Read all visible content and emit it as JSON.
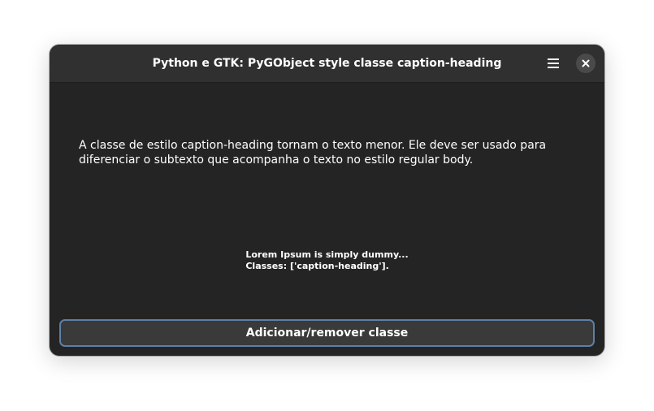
{
  "window": {
    "title": "Python e GTK: PyGObject style classe caption-heading",
    "menu_icon": "hamburger-menu-icon",
    "close_icon": "close-icon"
  },
  "content": {
    "description": "A classe de estilo caption-heading tornam o texto menor. Ele deve ser usado para diferenciar o subtexto que acompanha o texto no estilo regular body.",
    "label_line1": "Lorem Ipsum is simply dummy...",
    "label_line2": "Classes: ['caption-heading']."
  },
  "actions": {
    "toggle_button_label": "Adicionar/remover classe"
  },
  "colors": {
    "window_bg": "#242424",
    "headerbar_bg": "#303030",
    "button_bg": "#3a3a3a",
    "focus_ring": "#5e7fa6",
    "text": "#ffffff"
  }
}
